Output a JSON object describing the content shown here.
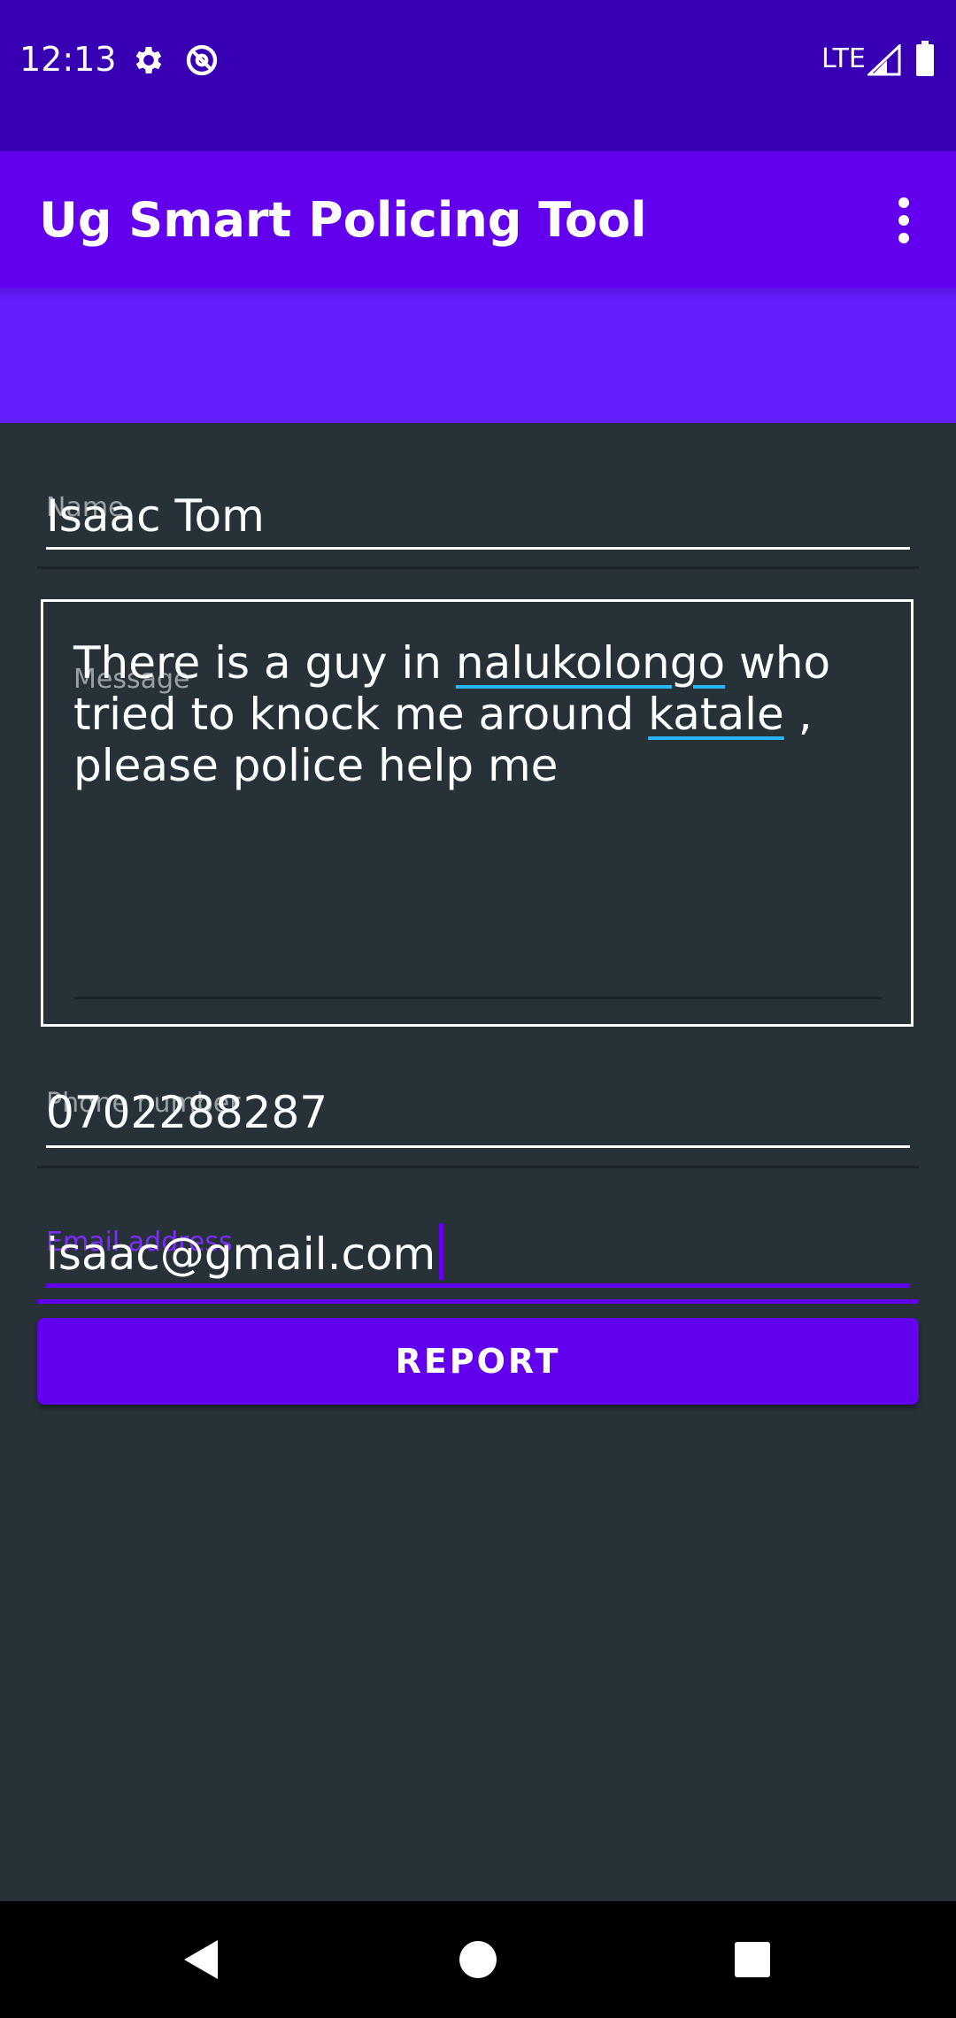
{
  "status_bar": {
    "time": "12:13",
    "network": "LTE",
    "icons": [
      "settings-icon",
      "data-saver-icon",
      "signal-icon",
      "battery-icon"
    ]
  },
  "app_bar": {
    "title": "Ug Smart Policing Tool",
    "menu_icon": "more-vert-icon"
  },
  "form": {
    "name": {
      "label": "Name",
      "value": "Isaac Tom"
    },
    "message": {
      "label": "Message",
      "segments": [
        "There is a guy in ",
        "nalukolongo",
        " who tried to knock me around ",
        "katale",
        " , please police help me"
      ]
    },
    "phone": {
      "label": "Phone number",
      "value": "0702288287"
    },
    "email": {
      "label": "Email address",
      "value": "isaac@gmail.com"
    },
    "report_label": "REPORT"
  },
  "colors": {
    "status_bar": "#3700b3",
    "app_bar": "#6200ee",
    "header_band": "#651fff",
    "background": "#263238",
    "accent": "#6200ee",
    "spellcheck_underline": "#29b6f6"
  },
  "nav_bar": {
    "icons": [
      "back-icon",
      "home-icon",
      "recents-icon"
    ]
  }
}
